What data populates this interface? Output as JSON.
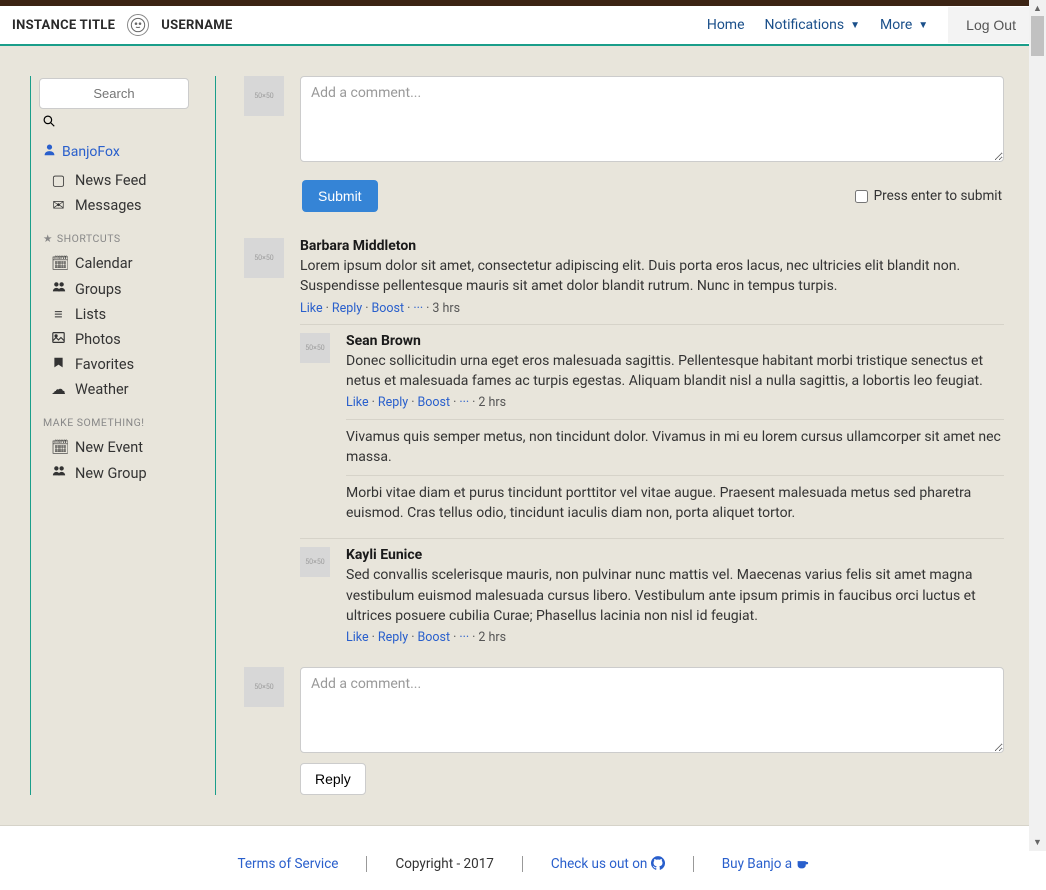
{
  "header": {
    "instance_title": "INSTANCE TITLE",
    "username": "USERNAME",
    "nav": {
      "home": "Home",
      "notifications": "Notifications",
      "more": "More"
    },
    "logout": "Log Out"
  },
  "sidebar": {
    "search_placeholder": "Search",
    "profile": "BanjoFox",
    "items_primary": [
      {
        "label": "News Feed"
      },
      {
        "label": "Messages"
      }
    ],
    "shortcuts_heading": "SHORTCUTS",
    "items_shortcuts": [
      {
        "label": "Calendar"
      },
      {
        "label": "Groups"
      },
      {
        "label": "Lists"
      },
      {
        "label": "Photos"
      },
      {
        "label": "Favorites"
      },
      {
        "label": "Weather"
      }
    ],
    "make_heading": "MAKE SOMETHING!",
    "items_make": [
      {
        "label": "New Event"
      },
      {
        "label": "New Group"
      }
    ]
  },
  "compose": {
    "placeholder": "Add a comment...",
    "submit": "Submit",
    "press_enter": "Press enter to submit"
  },
  "comments": [
    {
      "author": "Barbara Middleton",
      "text": "Lorem ipsum dolor sit amet, consectetur adipiscing elit. Duis porta eros lacus, nec ultricies elit blandit non. Suspendisse pellentesque mauris sit amet dolor blandit rutrum. Nunc in tempus turpis.",
      "time": "3 hrs",
      "replies": [
        {
          "author": "Sean Brown",
          "text": "Donec sollicitudin urna eget eros malesuada sagittis. Pellentesque habitant morbi tristique senectus et netus et malesuada fames ac turpis egestas. Aliquam blandit nisl a nulla sagittis, a lobortis leo feugiat.",
          "time": "2 hrs",
          "continuation": [
            "Vivamus quis semper metus, non tincidunt dolor. Vivamus in mi eu lorem cursus ullamcorper sit amet nec massa.",
            "Morbi vitae diam et purus tincidunt porttitor vel vitae augue. Praesent malesuada metus sed pharetra euismod. Cras tellus odio, tincidunt iaculis diam non, porta aliquet tortor."
          ]
        },
        {
          "author": "Kayli Eunice",
          "text": "Sed convallis scelerisque mauris, non pulvinar nunc mattis vel. Maecenas varius felis sit amet magna vestibulum euismod malesuada cursus libero. Vestibulum ante ipsum primis in faucibus orci luctus et ultrices posuere cubilia Curae; Phasellus lacinia non nisl id feugiat.",
          "time": "2 hrs"
        }
      ]
    }
  ],
  "actions": {
    "like": "Like",
    "reply": "Reply",
    "boost": "Boost"
  },
  "reply": {
    "placeholder": "Add a comment...",
    "button": "Reply"
  },
  "avatar_placeholder": "50×50",
  "footer": {
    "tos": "Terms of Service",
    "copyright": "Copyright - 2017",
    "github": "Check us out on",
    "donate": "Buy Banjo a"
  }
}
